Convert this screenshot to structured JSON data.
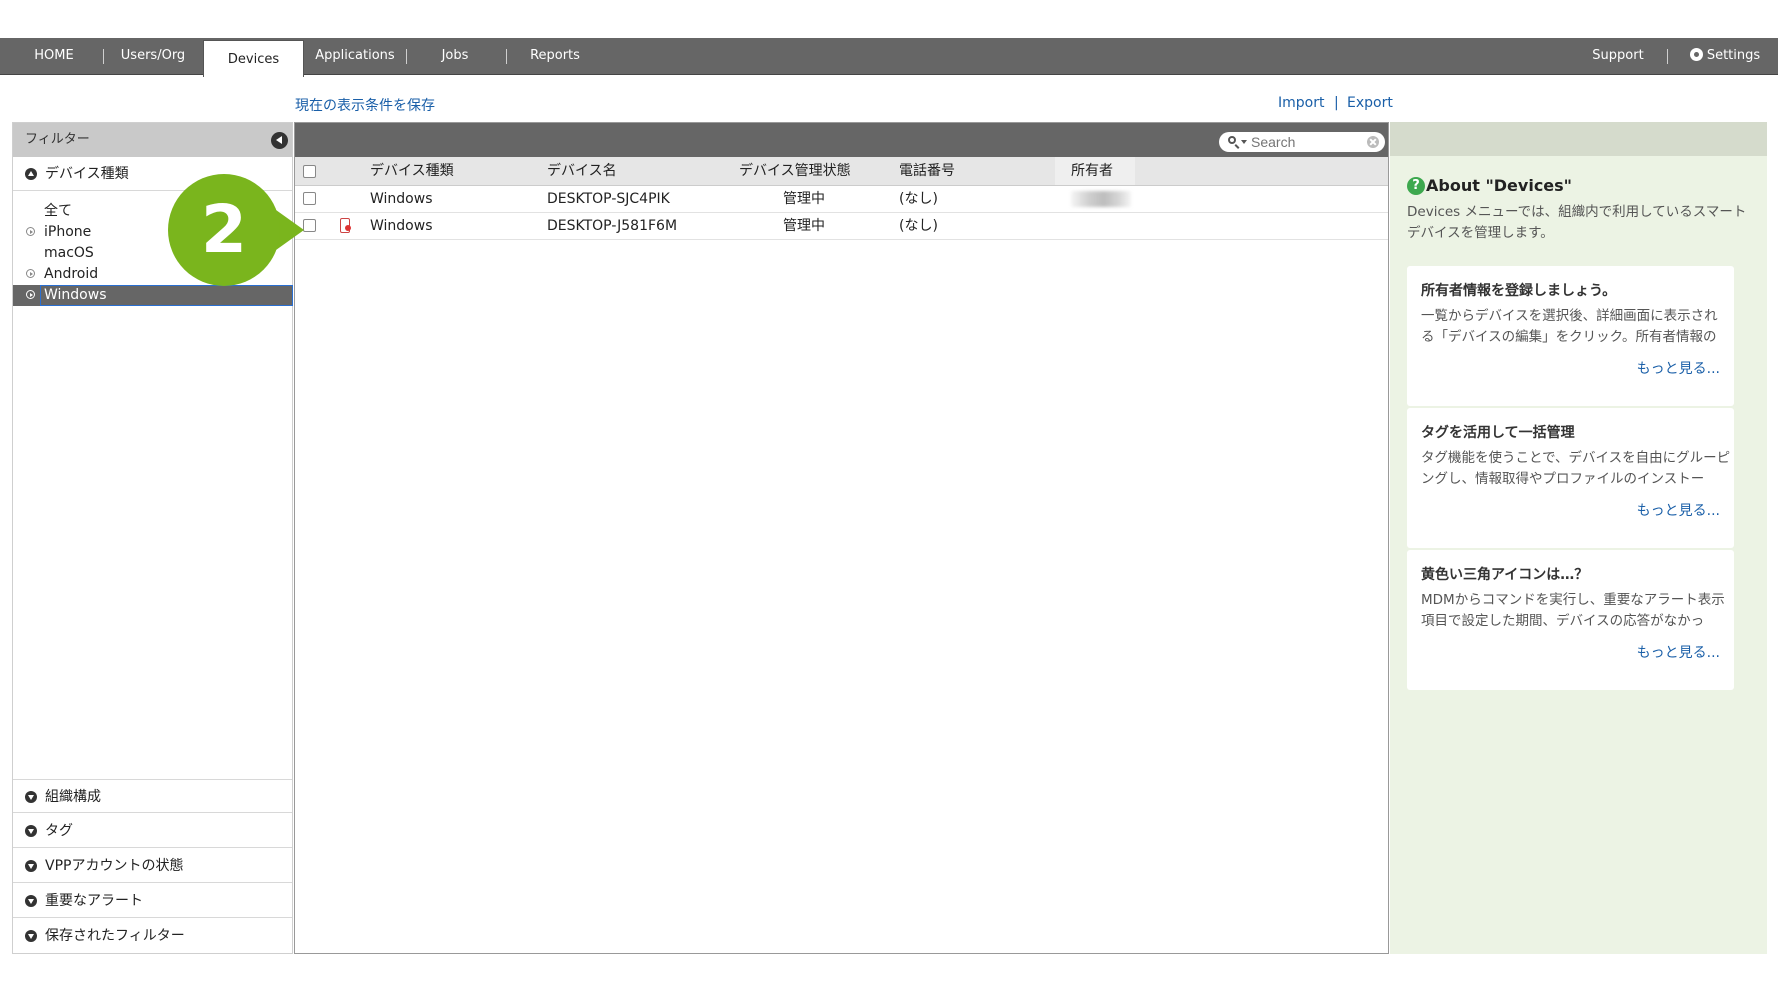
{
  "topnav": {
    "tabs": [
      "HOME",
      "Users/Org",
      "Devices",
      "Applications",
      "Jobs",
      "Reports"
    ],
    "active_tab": "Devices",
    "support": "Support",
    "settings": "Settings"
  },
  "links": {
    "save_view": "現在の表示条件を保存",
    "import": "Import",
    "separator": "|",
    "export": "Export"
  },
  "filter": {
    "title": "フィルター",
    "device_type": {
      "label": "デバイス種類",
      "items": [
        {
          "label": "全て",
          "expandable": false,
          "selected": false
        },
        {
          "label": "iPhone",
          "expandable": true,
          "selected": false
        },
        {
          "label": "macOS",
          "expandable": false,
          "selected": false
        },
        {
          "label": "Android",
          "expandable": true,
          "selected": false
        },
        {
          "label": "Windows",
          "expandable": true,
          "selected": true
        }
      ]
    },
    "sections": [
      "組織構成",
      "タグ",
      "VPPアカウントの状態",
      "重要なアラート",
      "保存されたフィルター"
    ]
  },
  "search": {
    "placeholder": "Search"
  },
  "table": {
    "columns": [
      "デバイス種類",
      "デバイス名",
      "デバイス管理状態",
      "電話番号",
      "所有者"
    ],
    "rows": [
      {
        "type": "Windows",
        "name": "DESKTOP-SJC4PIK",
        "status": "管理中",
        "phone": "(なし)",
        "owner_blurred": true,
        "alert_icon": false
      },
      {
        "type": "Windows",
        "name": "DESKTOP-J581F6M",
        "status": "管理中",
        "phone": "(なし)",
        "owner_blurred": false,
        "alert_icon": true
      }
    ]
  },
  "help": {
    "title": "About \"Devices\"",
    "icon": "?",
    "description": "Devices メニューでは、組織内で利用しているスマートデバイスを管理します。",
    "cards": [
      {
        "title": "所有者情報を登録しましょう。",
        "body": "一覧からデバイスを選択後、詳細画面に表示される「デバイスの編集」をクリック。所有者情報の",
        "more": "もっと見る..."
      },
      {
        "title": "タグを活用して一括管理",
        "body": "タグ機能を使うことで、デバイスを自由にグルーピングし、情報取得やプロファイルのインストー",
        "more": "もっと見る..."
      },
      {
        "title": "黄色い三角アイコンは…？",
        "body": "MDMからコマンドを実行し、重要なアラート表示項目で設定した期間、デバイスの応答がなかっ",
        "more": "もっと見る..."
      }
    ]
  },
  "callout": {
    "number": "2"
  },
  "colors": {
    "nav_bg": "#666666",
    "link": "#1a5fa8",
    "help_bg": "#ecf3e4",
    "callout": "#7ab51d"
  }
}
